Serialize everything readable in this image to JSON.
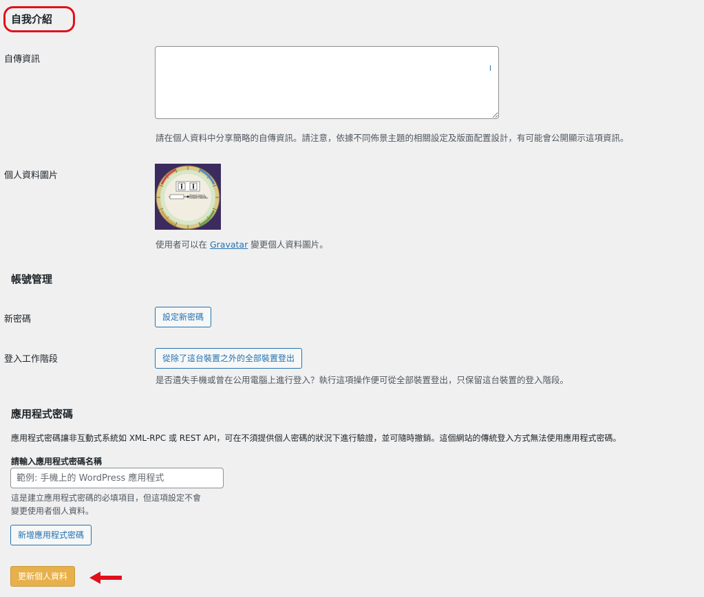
{
  "about_section": {
    "title": "自我介紹"
  },
  "bio": {
    "label": "自傳資訊",
    "value": "",
    "description": "請在個人資料中分享簡略的自傳資訊。請注意，依據不同佈景主題的相關設定及版面配置設計，有可能會公開顯示這項資訊。"
  },
  "avatar": {
    "label": "個人資料圖片",
    "image_alt": "Gravatar profile image",
    "image_caption_line1": "Shared Goal &",
    "image_caption_line2": "Custom Calendar",
    "description_prefix": "使用者可以在 ",
    "description_link": "Gravatar",
    "description_suffix": " 變更個人資料圖片。"
  },
  "account_section": {
    "title": "帳號管理"
  },
  "new_password": {
    "label": "新密碼",
    "button": "設定新密碼"
  },
  "sessions": {
    "label": "登入工作階段",
    "button": "從除了這台裝置之外的全部裝置登出",
    "description": "是否遺失手機或曾在公用電腦上進行登入？執行這項操作便可從全部裝置登出，只保留這台裝置的登入階段。"
  },
  "app_passwords": {
    "title": "應用程式密碼",
    "description": "應用程式密碼讓非互動式系統如 XML-RPC 或 REST API，可在不須提供個人密碼的狀況下進行驗證，並可隨時撤銷。這個網站的傳統登入方式無法使用應用程式密碼。",
    "name_label": "請輸入應用程式密碼名稱",
    "name_value": "",
    "name_placeholder": "範例: 手機上的 WordPress 應用程式",
    "help_line1": "這是建立應用程式密碼的必填項目，但這項設定不會",
    "help_line2": "變更使用者個人資料。",
    "add_button": "新增應用程式密碼"
  },
  "submit": {
    "button": "更新個人資料"
  },
  "colors": {
    "background": "#f0f0f1",
    "link": "#2271b1",
    "primary_button": "#e8b04a",
    "annotation_red": "#e0101a"
  },
  "annotations": {
    "title_highlight": "red-rounded-rectangle",
    "submit_pointer": "red-left-arrow"
  }
}
